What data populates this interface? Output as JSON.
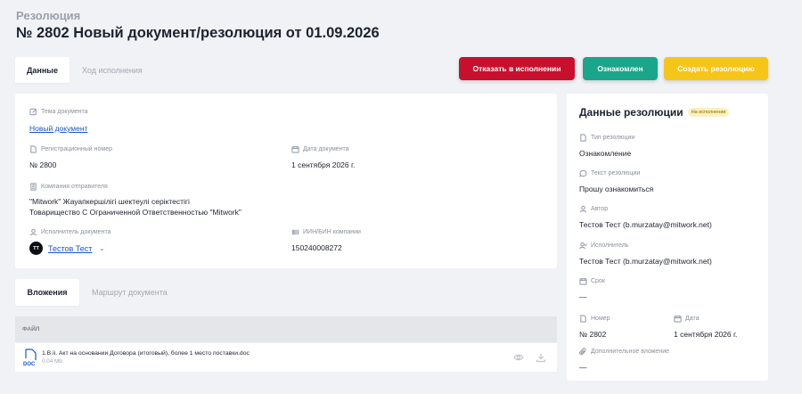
{
  "header": {
    "subtitle": "Резолюция",
    "title": "№ 2802 Новый документ/резолюция от 01.09.2026"
  },
  "tabs_top": [
    "Данные",
    "Ход исполнения"
  ],
  "actions": {
    "reject": "Отказать в исполнении",
    "ack": "Ознакомлен",
    "create": "Создать резолюцию"
  },
  "document": {
    "topic_label": "Тема документа",
    "topic_value": "Новый документ",
    "reg_label": "Регистрационный номер",
    "reg_value": "№ 2800",
    "date_label": "Дата документа",
    "date_value": "1 сентября 2026 г.",
    "sender_label": "Компания отправителя",
    "sender_line1": "\"Mitwork\" Жауапкершілігі шектеулі серіктестігі",
    "sender_line2": "Товарищество С Ограниченной Ответственностью \"Mitwork\"",
    "executor_label": "Исполнитель документа",
    "executor_initials": "ТТ",
    "executor_name": "Тестов Тест",
    "iin_label": "ИИН/БИН компании",
    "iin_value": "150240008272"
  },
  "tabs_bottom": [
    "Вложения",
    "Маршрут документа"
  ],
  "attachments": {
    "column": "ФАЙЛ",
    "file_type": "DOC",
    "file_name": "1.В.іі. Акт на основании Договора (итоговый), более 1 место поставки.doc",
    "file_size": "0.04 Mb"
  },
  "resolution": {
    "title": "Данные резолюции",
    "badge": "На исполнении",
    "type_label": "Тип резолюции",
    "type_value": "Ознакомление",
    "text_label": "Текст резолюции",
    "text_value": "Прошу ознакомиться",
    "author_label": "Автор",
    "author_value": "Тестов Тест (b.murzatay@mitwork.net)",
    "executor_label": "Исполнитель",
    "executor_value": "Тестов Тест (b.murzatay@mitwork.net)",
    "deadline_label": "Срок",
    "deadline_value": "—",
    "number_label": "Номер",
    "number_value": "№ 2802",
    "date_label": "Дата",
    "date_value": "1 сентября 2026 г.",
    "extra_label": "Дополнительное вложение",
    "extra_value": "—"
  },
  "colors": {
    "reject": "#c8102e",
    "ack": "#1aa68a",
    "create": "#f5c518",
    "link": "#1a56c4"
  }
}
